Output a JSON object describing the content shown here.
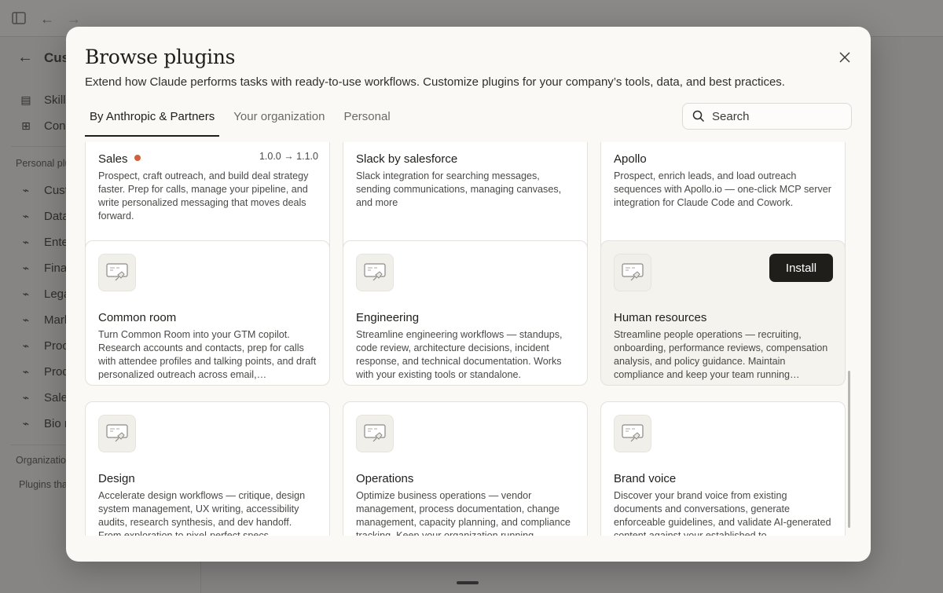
{
  "background": {
    "sidebar_title": "Cus",
    "sidebar_top_items": [
      "Skills",
      "Con"
    ],
    "personal_section_label": "Personal plu",
    "personal_items": [
      "Cust",
      "Data",
      "Ente",
      "Fina",
      "Lega",
      "Mark",
      "Proc",
      "Prod",
      "Sale",
      "Bio r"
    ],
    "org_section_label": "Organizatio",
    "org_note": "Plugins tha"
  },
  "modal": {
    "title": "Browse plugins",
    "subtitle": "Extend how Claude performs tasks with ready-to-use workflows. Customize plugins for your company’s tools, data, and best practices.",
    "close_icon": "close-icon",
    "tabs": [
      {
        "label": "By Anthropic & Partners",
        "active": true
      },
      {
        "label": "Your organization",
        "active": false
      },
      {
        "label": "Personal",
        "active": false
      }
    ],
    "search": {
      "placeholder": "Search",
      "value": ""
    },
    "install_label": "Install",
    "plugins": [
      {
        "name": "Sales",
        "version": "1.0.0 → 1.1.0",
        "new": true,
        "desc": "Prospect, craft outreach, and build deal strategy faster. Prep for calls, manage your pipeline, and write personalized messaging that moves deals forward."
      },
      {
        "name": "Slack by salesforce",
        "desc": "Slack integration for searching messages, sending communications, managing canvases, and more"
      },
      {
        "name": "Apollo",
        "desc": "Prospect, enrich leads, and load outreach sequences with Apollo.io — one-click MCP server integration for Claude Code and Cowork."
      },
      {
        "name": "Common room",
        "desc": "Turn Common Room into your GTM copilot. Research accounts and contacts, prep for calls with attendee profiles and talking points, and draft personalized outreach across email,…"
      },
      {
        "name": "Engineering",
        "desc": "Streamline engineering workflows — standups, code review, architecture decisions, incident response, and technical documentation. Works with your existing tools or standalone."
      },
      {
        "name": "Human resources",
        "desc": "Streamline people operations — recruiting, onboarding, performance reviews, compensation analysis, and policy guidance. Maintain compliance and keep your team running…"
      },
      {
        "name": "Design",
        "desc": "Accelerate design workflows — critique, design system management, UX writing, accessibility audits, research synthesis, and dev handoff. From exploration to pixel-perfect specs."
      },
      {
        "name": "Operations",
        "desc": "Optimize business operations — vendor management, process documentation, change management, capacity planning, and compliance tracking. Keep your organization running…"
      },
      {
        "name": "Brand voice",
        "desc": "Discover your brand voice from existing documents and conversations, generate enforceable guidelines, and validate AI-generated content against your established to…"
      }
    ]
  }
}
